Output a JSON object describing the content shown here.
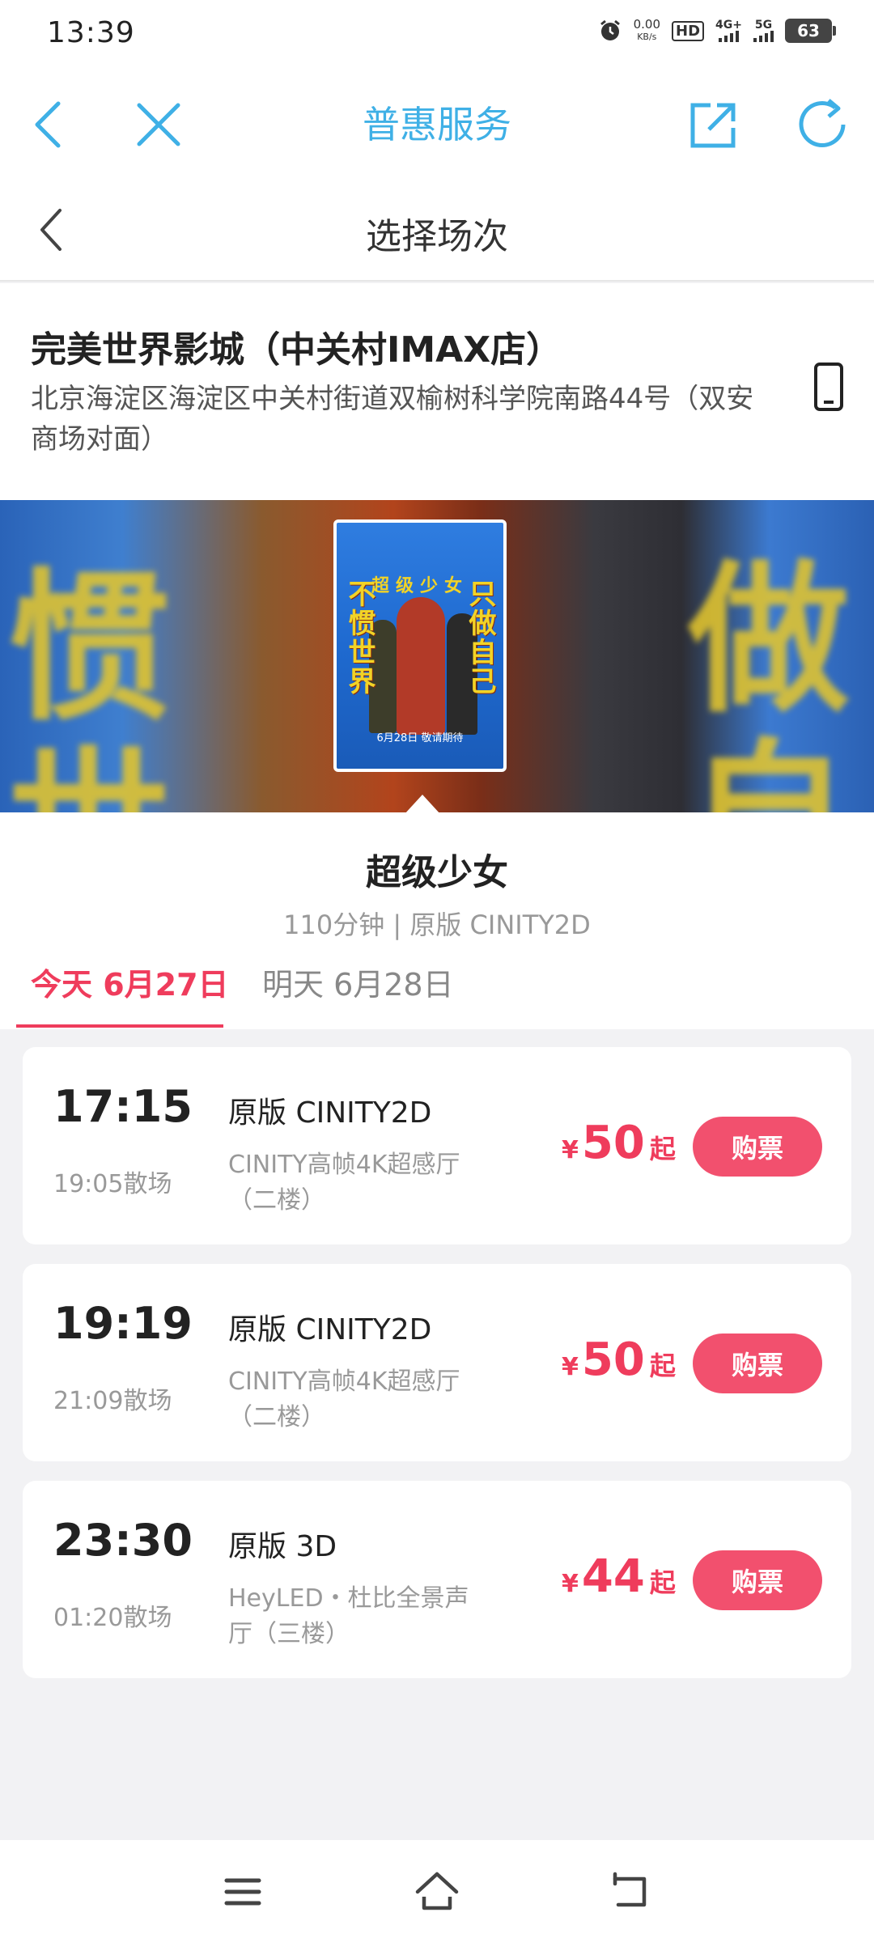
{
  "status_bar": {
    "time": "13:39",
    "net_speed_value": "0.00",
    "net_speed_unit": "KB/s",
    "hd_label": "HD",
    "network_4g": "4G+",
    "network_5g": "5G",
    "battery": "63"
  },
  "nav": {
    "title": "普惠服务"
  },
  "subheader": {
    "title": "选择场次"
  },
  "cinema": {
    "name": "完美世界影城（中关村IMAX店）",
    "address": "北京海淀区海淀区中关村街道双榆树科学院南路44号（双安商场对面）"
  },
  "poster": {
    "top_text": "超级少女",
    "left_text": "不惯世界",
    "right_text": "只做自己",
    "date_text": "6月28日 敬请期待"
  },
  "movie": {
    "title": "超级少女",
    "meta": "110分钟 |  原版 CINITY2D"
  },
  "date_tabs": [
    {
      "label": "今天 6月27日",
      "active": true
    },
    {
      "label": "明天 6月28日",
      "active": false
    }
  ],
  "showtimes": [
    {
      "start": "17:15",
      "end": "19:05散场",
      "version": "原版 CINITY2D",
      "hall": "CINITY高帧4K超感厅（二楼）",
      "currency": "¥",
      "price": "50",
      "price_suffix": "起",
      "buy_label": "购票"
    },
    {
      "start": "19:19",
      "end": "21:09散场",
      "version": "原版 CINITY2D",
      "hall": "CINITY高帧4K超感厅（二楼）",
      "currency": "¥",
      "price": "50",
      "price_suffix": "起",
      "buy_label": "购票"
    },
    {
      "start": "23:30",
      "end": "01:20散场",
      "version": "原版 3D",
      "hall": "HeyLED・杜比全景声厅（三楼）",
      "currency": "¥",
      "price": "44",
      "price_suffix": "起",
      "buy_label": "购票"
    }
  ],
  "colors": {
    "accent_blue": "#3fb0e6",
    "accent_red": "#ef3c5c",
    "buy_button": "#f2506e"
  },
  "icons": {
    "back": "chevron-left-icon",
    "close": "close-icon",
    "share": "share-icon",
    "refresh": "refresh-icon",
    "phone": "phone-icon",
    "menu": "menu-icon",
    "home": "home-icon",
    "return": "return-icon"
  }
}
